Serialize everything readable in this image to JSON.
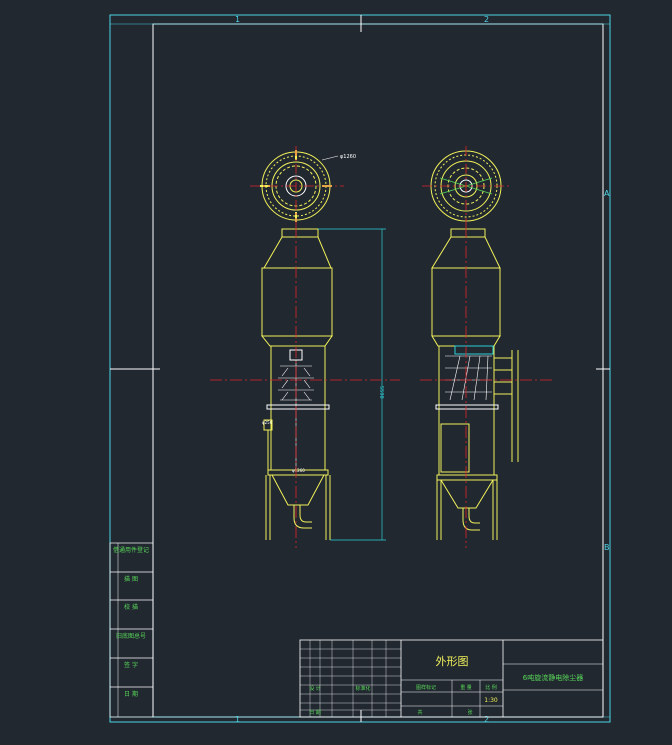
{
  "border": {
    "top_zone_1": "1",
    "top_zone_2": "2",
    "bottom_zone_1": "1",
    "bottom_zone_2": "2",
    "right_zone_a": "A",
    "right_zone_b": "B"
  },
  "left_column_labels": [
    "借通用件登记",
    "描 图",
    "校 描",
    "旧底图总号",
    "签 字",
    "日 期"
  ],
  "title_block": {
    "drawing_title": "外形图",
    "part_name": "6吨旋流静电除尘器",
    "scale_label": "比 例",
    "scale_value": "1:30",
    "mark_label": "图样标记",
    "weight_label": "重 量",
    "sheet_label": "共",
    "page_label": "张",
    "designer": "设 计",
    "sign": "标准化",
    "date": "日 期"
  },
  "annotations": {
    "top_dim_left": "φ1260",
    "overall_height": "5598",
    "inlet_dim": "φ250",
    "base_dim": "φ1260"
  },
  "colors": {
    "background": "#212830",
    "frame": "#ffffff",
    "border_cyan": "#4fd4e4",
    "equipment_yellow": "#f1f15a",
    "centerline_red": "#e0262a",
    "table_green": "#59d859",
    "dim_cyan": "#2ad0d8"
  }
}
